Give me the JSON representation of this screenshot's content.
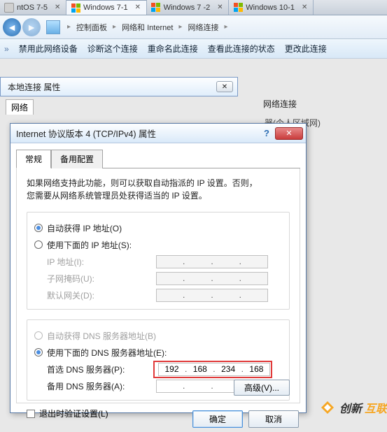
{
  "tabs": [
    {
      "label": "ntOS 7-5",
      "active": false
    },
    {
      "label": "Windows 7-1",
      "active": true
    },
    {
      "label": "Windows 7 -2",
      "active": false
    },
    {
      "label": "Windows 10-1",
      "active": false
    }
  ],
  "breadcrumb": [
    "控制面板",
    "网络和 Internet",
    "网络连接"
  ],
  "toolbar": {
    "disable": "禁用此网络设备",
    "diagnose": "诊断这个连接",
    "rename": "重命名此连接",
    "status": "查看此连接的状态",
    "change": "更改此连接"
  },
  "bg": {
    "prop_title": "本地连接 属性",
    "tab": "网络",
    "net_label": "网络连接",
    "info2": "器(个人区域网)"
  },
  "dialog": {
    "title": "Internet 协议版本 4 (TCP/IPv4) 属性",
    "tabs": [
      "常规",
      "备用配置"
    ],
    "desc1": "如果网络支持此功能，则可以获取自动指派的 IP 设置。否则，",
    "desc2": "您需要从网络系统管理员处获得适当的 IP 设置。",
    "radio_auto_ip": "自动获得 IP 地址(O)",
    "radio_manual_ip": "使用下面的 IP 地址(S):",
    "ip_label": "IP 地址(I):",
    "mask_label": "子网掩码(U):",
    "gw_label": "默认网关(D):",
    "radio_auto_dns": "自动获得 DNS 服务器地址(B)",
    "radio_manual_dns": "使用下面的 DNS 服务器地址(E):",
    "dns1_label": "首选 DNS 服务器(P):",
    "dns2_label": "备用 DNS 服务器(A):",
    "dns1": [
      "192",
      "168",
      "234",
      "168"
    ],
    "validate_label": "退出时验证设置(L)",
    "advanced": "高级(V)...",
    "ok": "确定",
    "cancel": "取消"
  },
  "watermark": {
    "t1": "创新",
    "t2": "互联"
  }
}
